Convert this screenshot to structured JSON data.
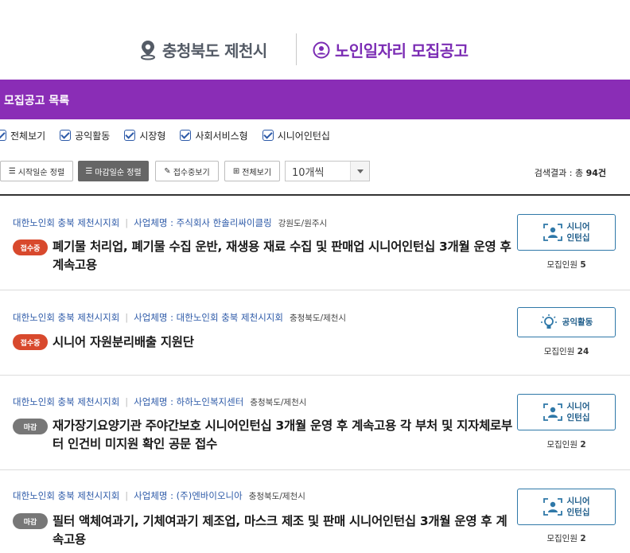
{
  "header": {
    "location": "충청북도 제천시",
    "title": "노인일자리 모집공고"
  },
  "section": {
    "title": "모집공고 목록"
  },
  "filters": [
    "전체보기",
    "공익활동",
    "시장형",
    "사회서비스형",
    "시니어인턴십"
  ],
  "toolbar": {
    "sort_start": "시작일순 정렬",
    "sort_deadline": "마감일순 정렬",
    "receiving": "접수중보기",
    "view_all": "전체보기",
    "per_page": "10개씩",
    "result_prefix": "검색결과 : 총 ",
    "result_count": "94건"
  },
  "items": [
    {
      "org": "대한노인회 충북 제천시지회",
      "company": "사업체명 : 주식회사 한솔리싸이클링",
      "region": "강원도/원주시",
      "status": "접수중",
      "title": "폐기물 처리업, 폐기물 수집 운반, 재생용 재료 수집 및 판매업 시니어인턴십 3개월 운영 후 계속고용",
      "type_line1": "시니어",
      "type_line2": "인턴십",
      "count_label": "모집인원",
      "count": "5"
    },
    {
      "org": "대한노인회 충북 제천시지회",
      "company": "사업체명 : 대한노인회 충북 제천시지회",
      "region": "충청북도/제천시",
      "status": "접수중",
      "title": "시니어 자원분리배출 지원단",
      "type_line1": "공익활동",
      "type_line2": "",
      "count_label": "모집인원",
      "count": "24"
    },
    {
      "org": "대한노인회 충북 제천시지회",
      "company": "사업체명 : 하하노인복지센터",
      "region": "충청북도/제천시",
      "status": "마감",
      "title": "재가장기요양기관 주야간보호 시니어인턴십 3개월 운영 후 계속고용 각 부처 및 지자체로부터 인건비 미지원 확인 공문 접수",
      "type_line1": "시니어",
      "type_line2": "인턴십",
      "count_label": "모집인원",
      "count": "2"
    },
    {
      "org": "대한노인회 충북 제천시지회",
      "company": "사업체명 : (주)엔바이오니아",
      "region": "충청북도/제천시",
      "status": "마감",
      "title": "필터 액체여과기, 기체여과기 제조업, 마스크 제조 및 판매 시니어인턴십 3개월 운영 후 계속고용",
      "type_line1": "시니어",
      "type_line2": "인턴십",
      "count_label": "모집인원",
      "count": "2"
    }
  ]
}
